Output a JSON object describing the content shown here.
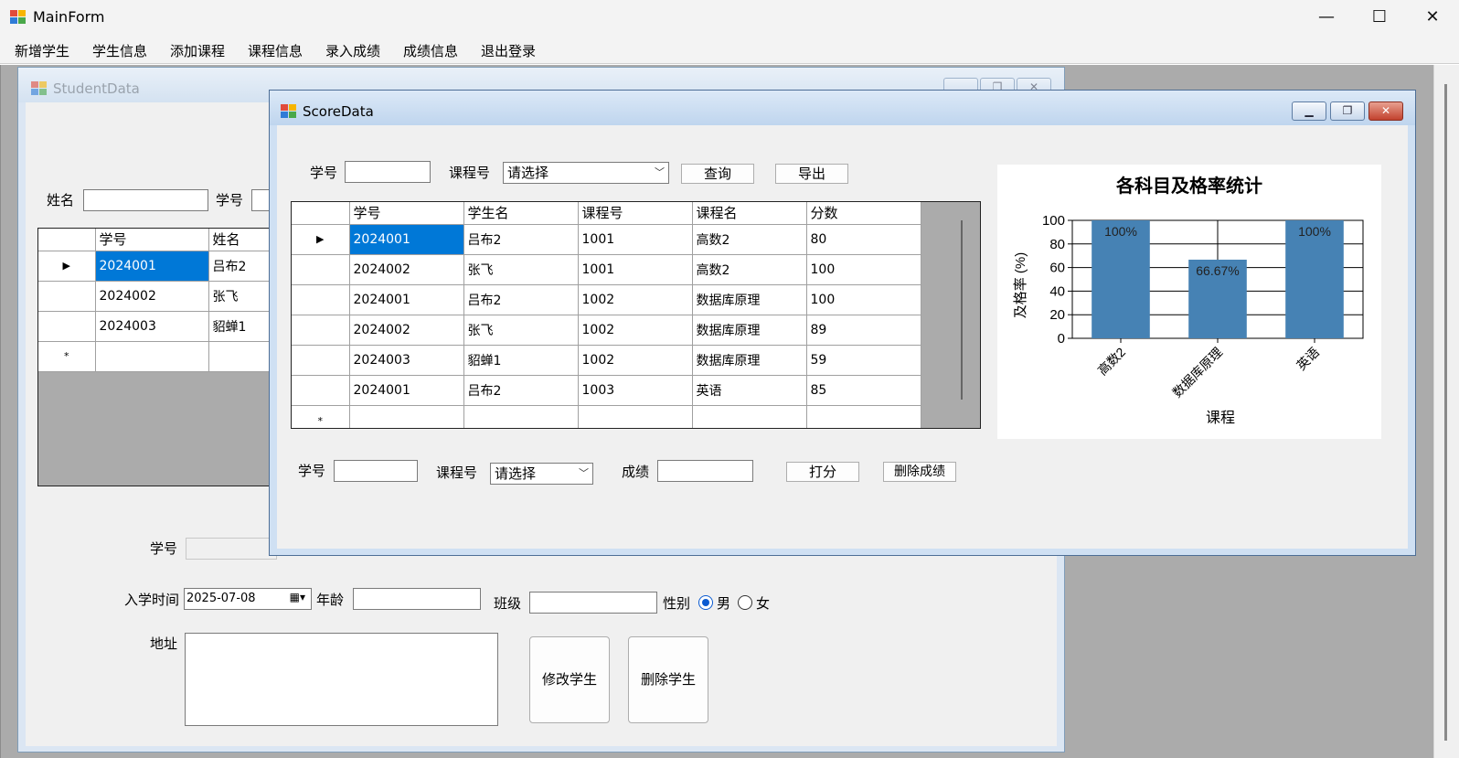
{
  "main_window": {
    "title": "MainForm",
    "menu": [
      "新增学生",
      "学生信息",
      "添加课程",
      "课程信息",
      "录入成绩",
      "成绩信息",
      "退出登录"
    ],
    "controls": {
      "minimize": "—",
      "maximize": "☐",
      "close": "✕"
    }
  },
  "student_window": {
    "title": "StudentData",
    "search": {
      "name_label": "姓名",
      "id_label": "学号"
    },
    "grid": {
      "columns": [
        "学号",
        "姓名"
      ],
      "rows": [
        [
          "2024001",
          "吕布2"
        ],
        [
          "2024002",
          "张飞"
        ],
        [
          "2024003",
          "貂蝉1"
        ]
      ],
      "new_row_marker": "*"
    },
    "form": {
      "id_label": "学号",
      "enroll_label": "入学时间",
      "enroll_value": "2025-07-08",
      "age_label": "年龄",
      "class_label": "班级",
      "gender_label": "性别",
      "gender_male": "男",
      "gender_female": "女",
      "address_label": "地址",
      "edit_button": "修改学生",
      "delete_button": "删除学生"
    }
  },
  "score_window": {
    "title": "ScoreData",
    "query": {
      "id_label": "学号",
      "course_label": "课程号",
      "course_select": "请选择",
      "query_button": "查询",
      "export_button": "导出"
    },
    "grid": {
      "columns": [
        "学号",
        "学生名",
        "课程号",
        "课程名",
        "分数"
      ],
      "rows": [
        [
          "2024001",
          "吕布2",
          "1001",
          "高数2",
          "80"
        ],
        [
          "2024002",
          "张飞",
          "1001",
          "高数2",
          "100"
        ],
        [
          "2024001",
          "吕布2",
          "1002",
          "数据库原理",
          "100"
        ],
        [
          "2024002",
          "张飞",
          "1002",
          "数据库原理",
          "89"
        ],
        [
          "2024003",
          "貂蝉1",
          "1002",
          "数据库原理",
          "59"
        ],
        [
          "2024001",
          "吕布2",
          "1003",
          "英语",
          "85"
        ]
      ],
      "new_row_marker": "*"
    },
    "entry": {
      "id_label": "学号",
      "course_label": "课程号",
      "course_select": "请选择",
      "score_label": "成绩",
      "score_button": "打分",
      "delete_button": "删除成绩"
    }
  },
  "chart_data": {
    "type": "bar",
    "title": "各科目及格率统计",
    "xlabel": "课程",
    "ylabel": "及格率 (%)",
    "categories": [
      "高数2",
      "数据库原理",
      "英语"
    ],
    "values": [
      100,
      66.67,
      100
    ],
    "data_labels": [
      "100%",
      "66.67%",
      "100%"
    ],
    "ylim": [
      0,
      100
    ],
    "yticks": [
      0,
      20,
      40,
      60,
      80,
      100
    ],
    "grid": true,
    "bar_color": "#4682b4"
  },
  "colors": {
    "selection": "#0078d7",
    "mdi_background": "#ababab"
  }
}
